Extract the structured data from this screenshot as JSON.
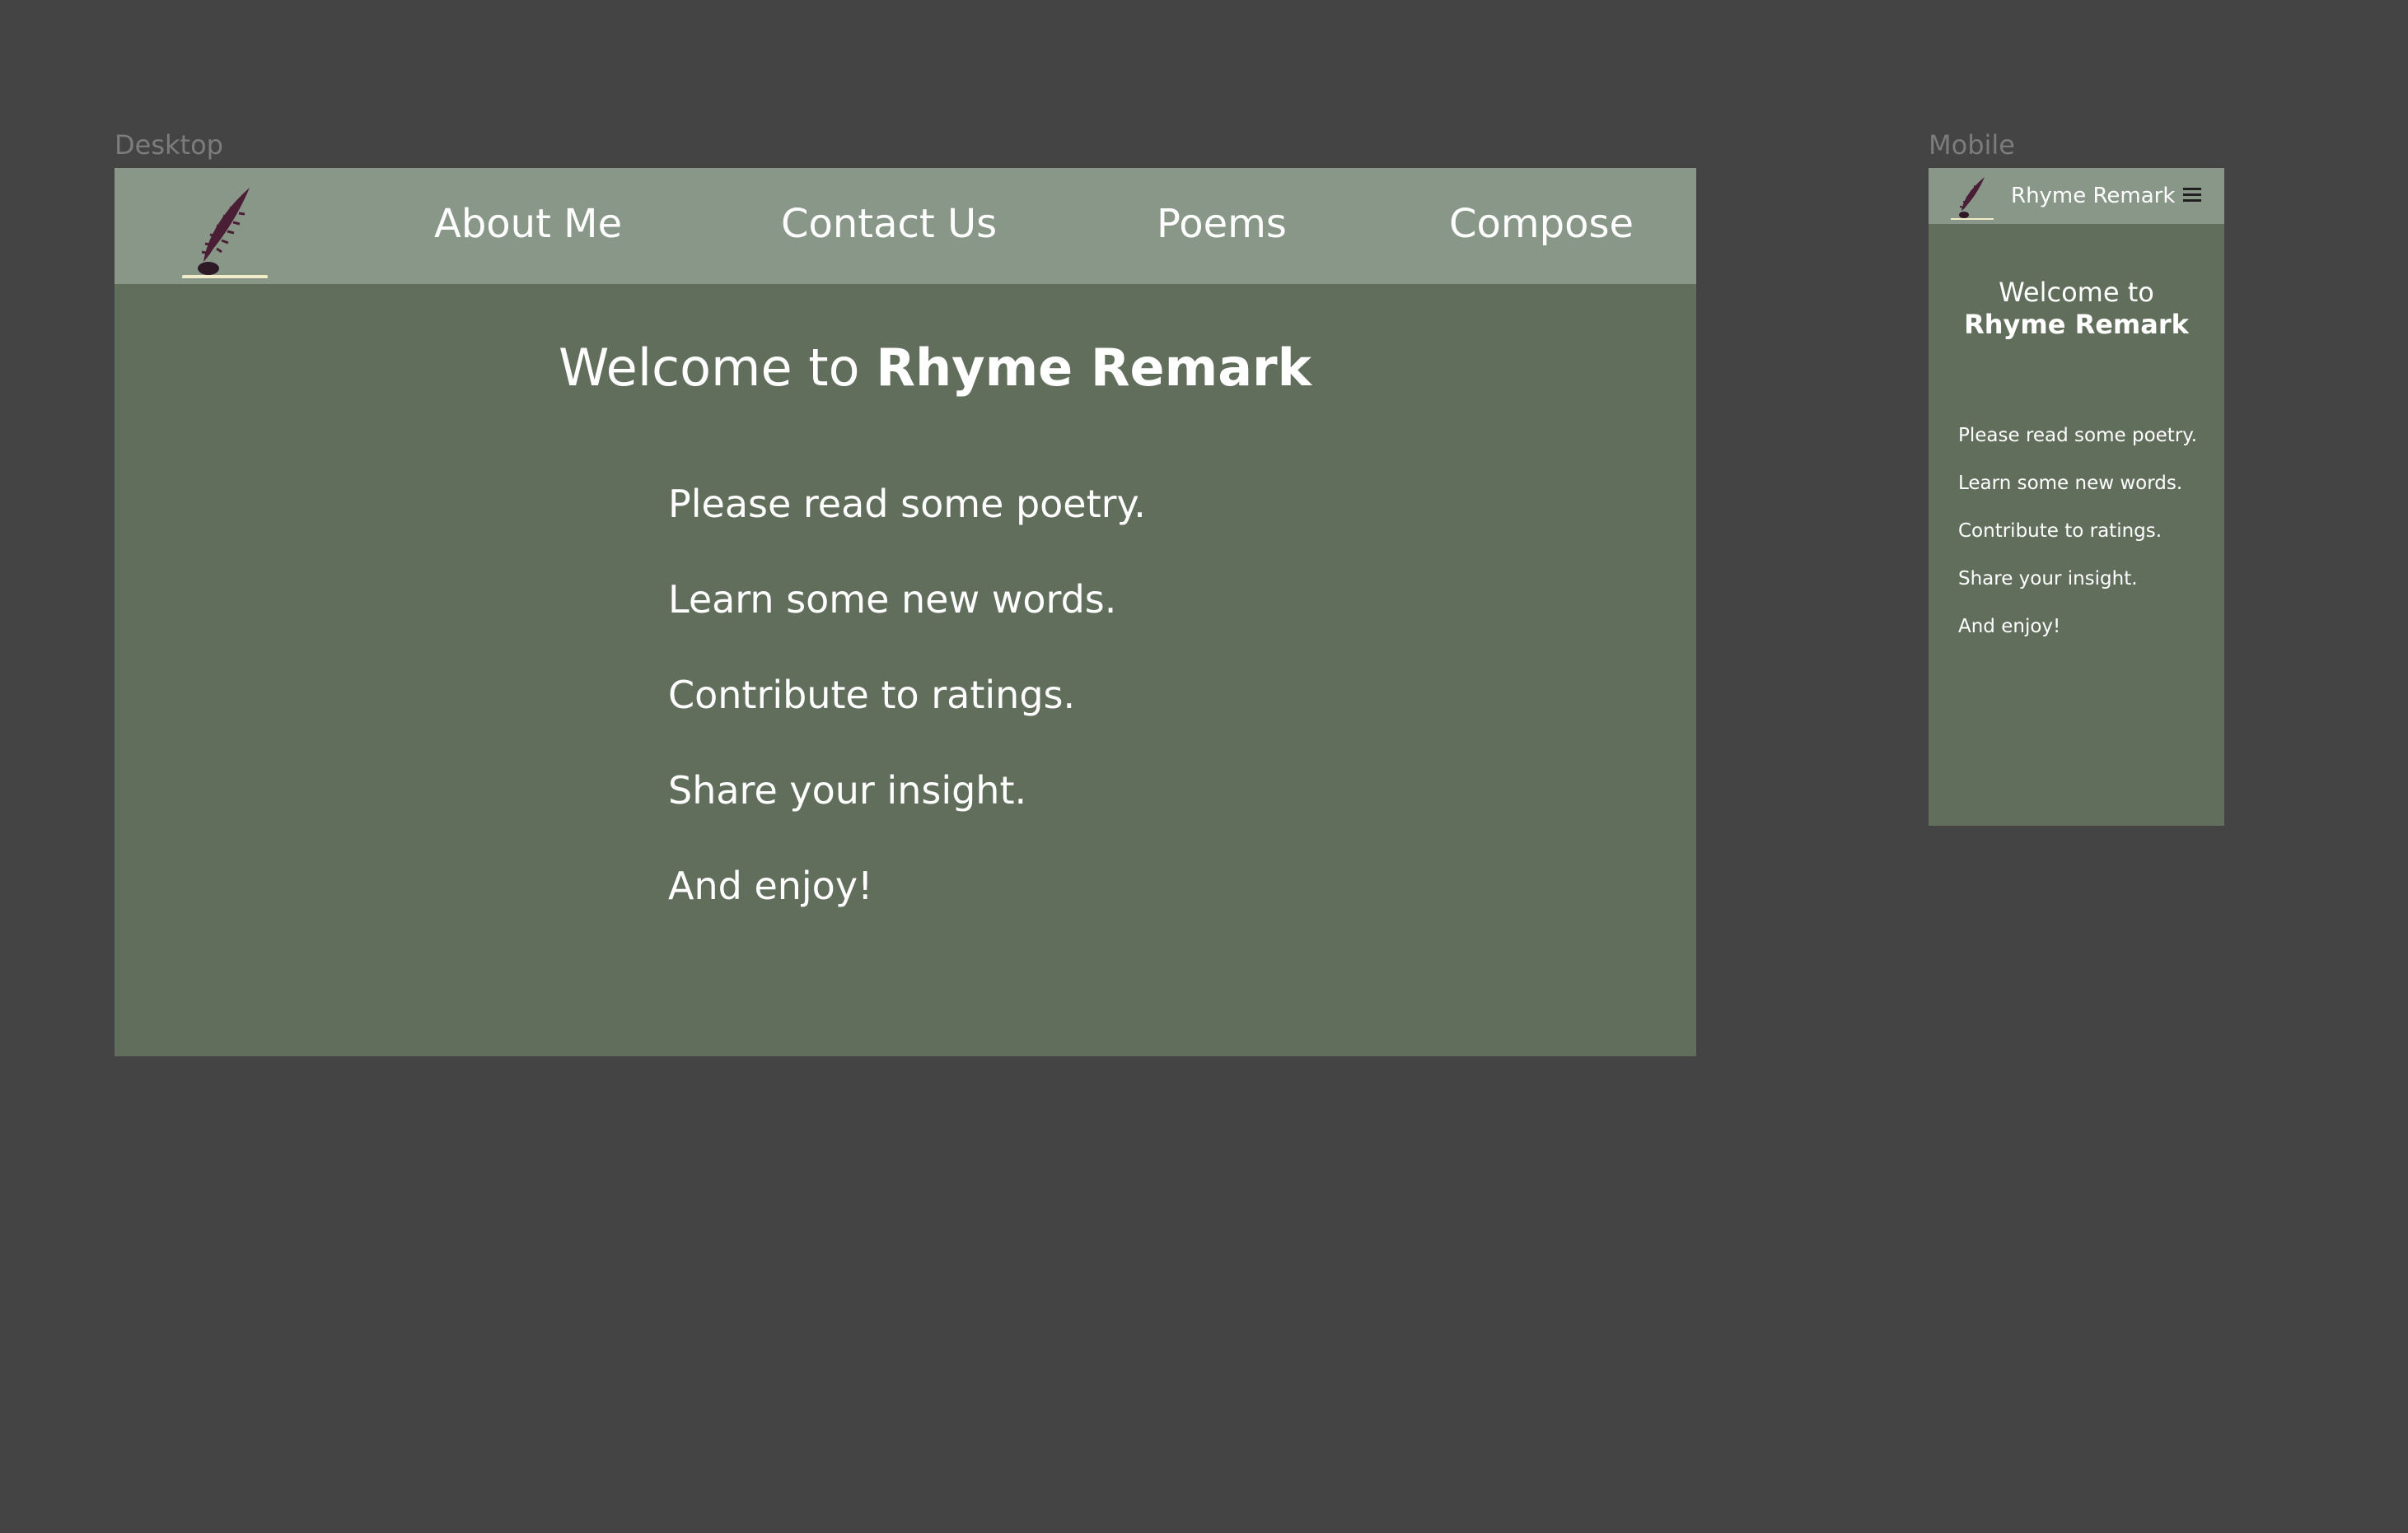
{
  "labels": {
    "desktop": "Desktop",
    "mobile": "Mobile"
  },
  "colors": {
    "canvas": "#444444",
    "nav_bar": "#899789",
    "page_bg": "#616e5c",
    "text": "#ffffff",
    "quill": "#4a1f36",
    "underline": "#f3ecc8"
  },
  "logo": {
    "icon": "quill-inkwell-icon"
  },
  "nav": {
    "items": [
      {
        "label": "About Me"
      },
      {
        "label": "Contact Us"
      },
      {
        "label": "Poems"
      },
      {
        "label": "Compose"
      }
    ]
  },
  "welcome": {
    "prefix": "Welcome to",
    "brand": "Rhyme Remark"
  },
  "lines": [
    "Please read some poetry.",
    "Learn some new words.",
    "Contribute to ratings.",
    "Share your insight.",
    "And enjoy!"
  ],
  "mobile": {
    "title": "Rhyme Remark",
    "menu_icon": "hamburger-menu-icon"
  }
}
